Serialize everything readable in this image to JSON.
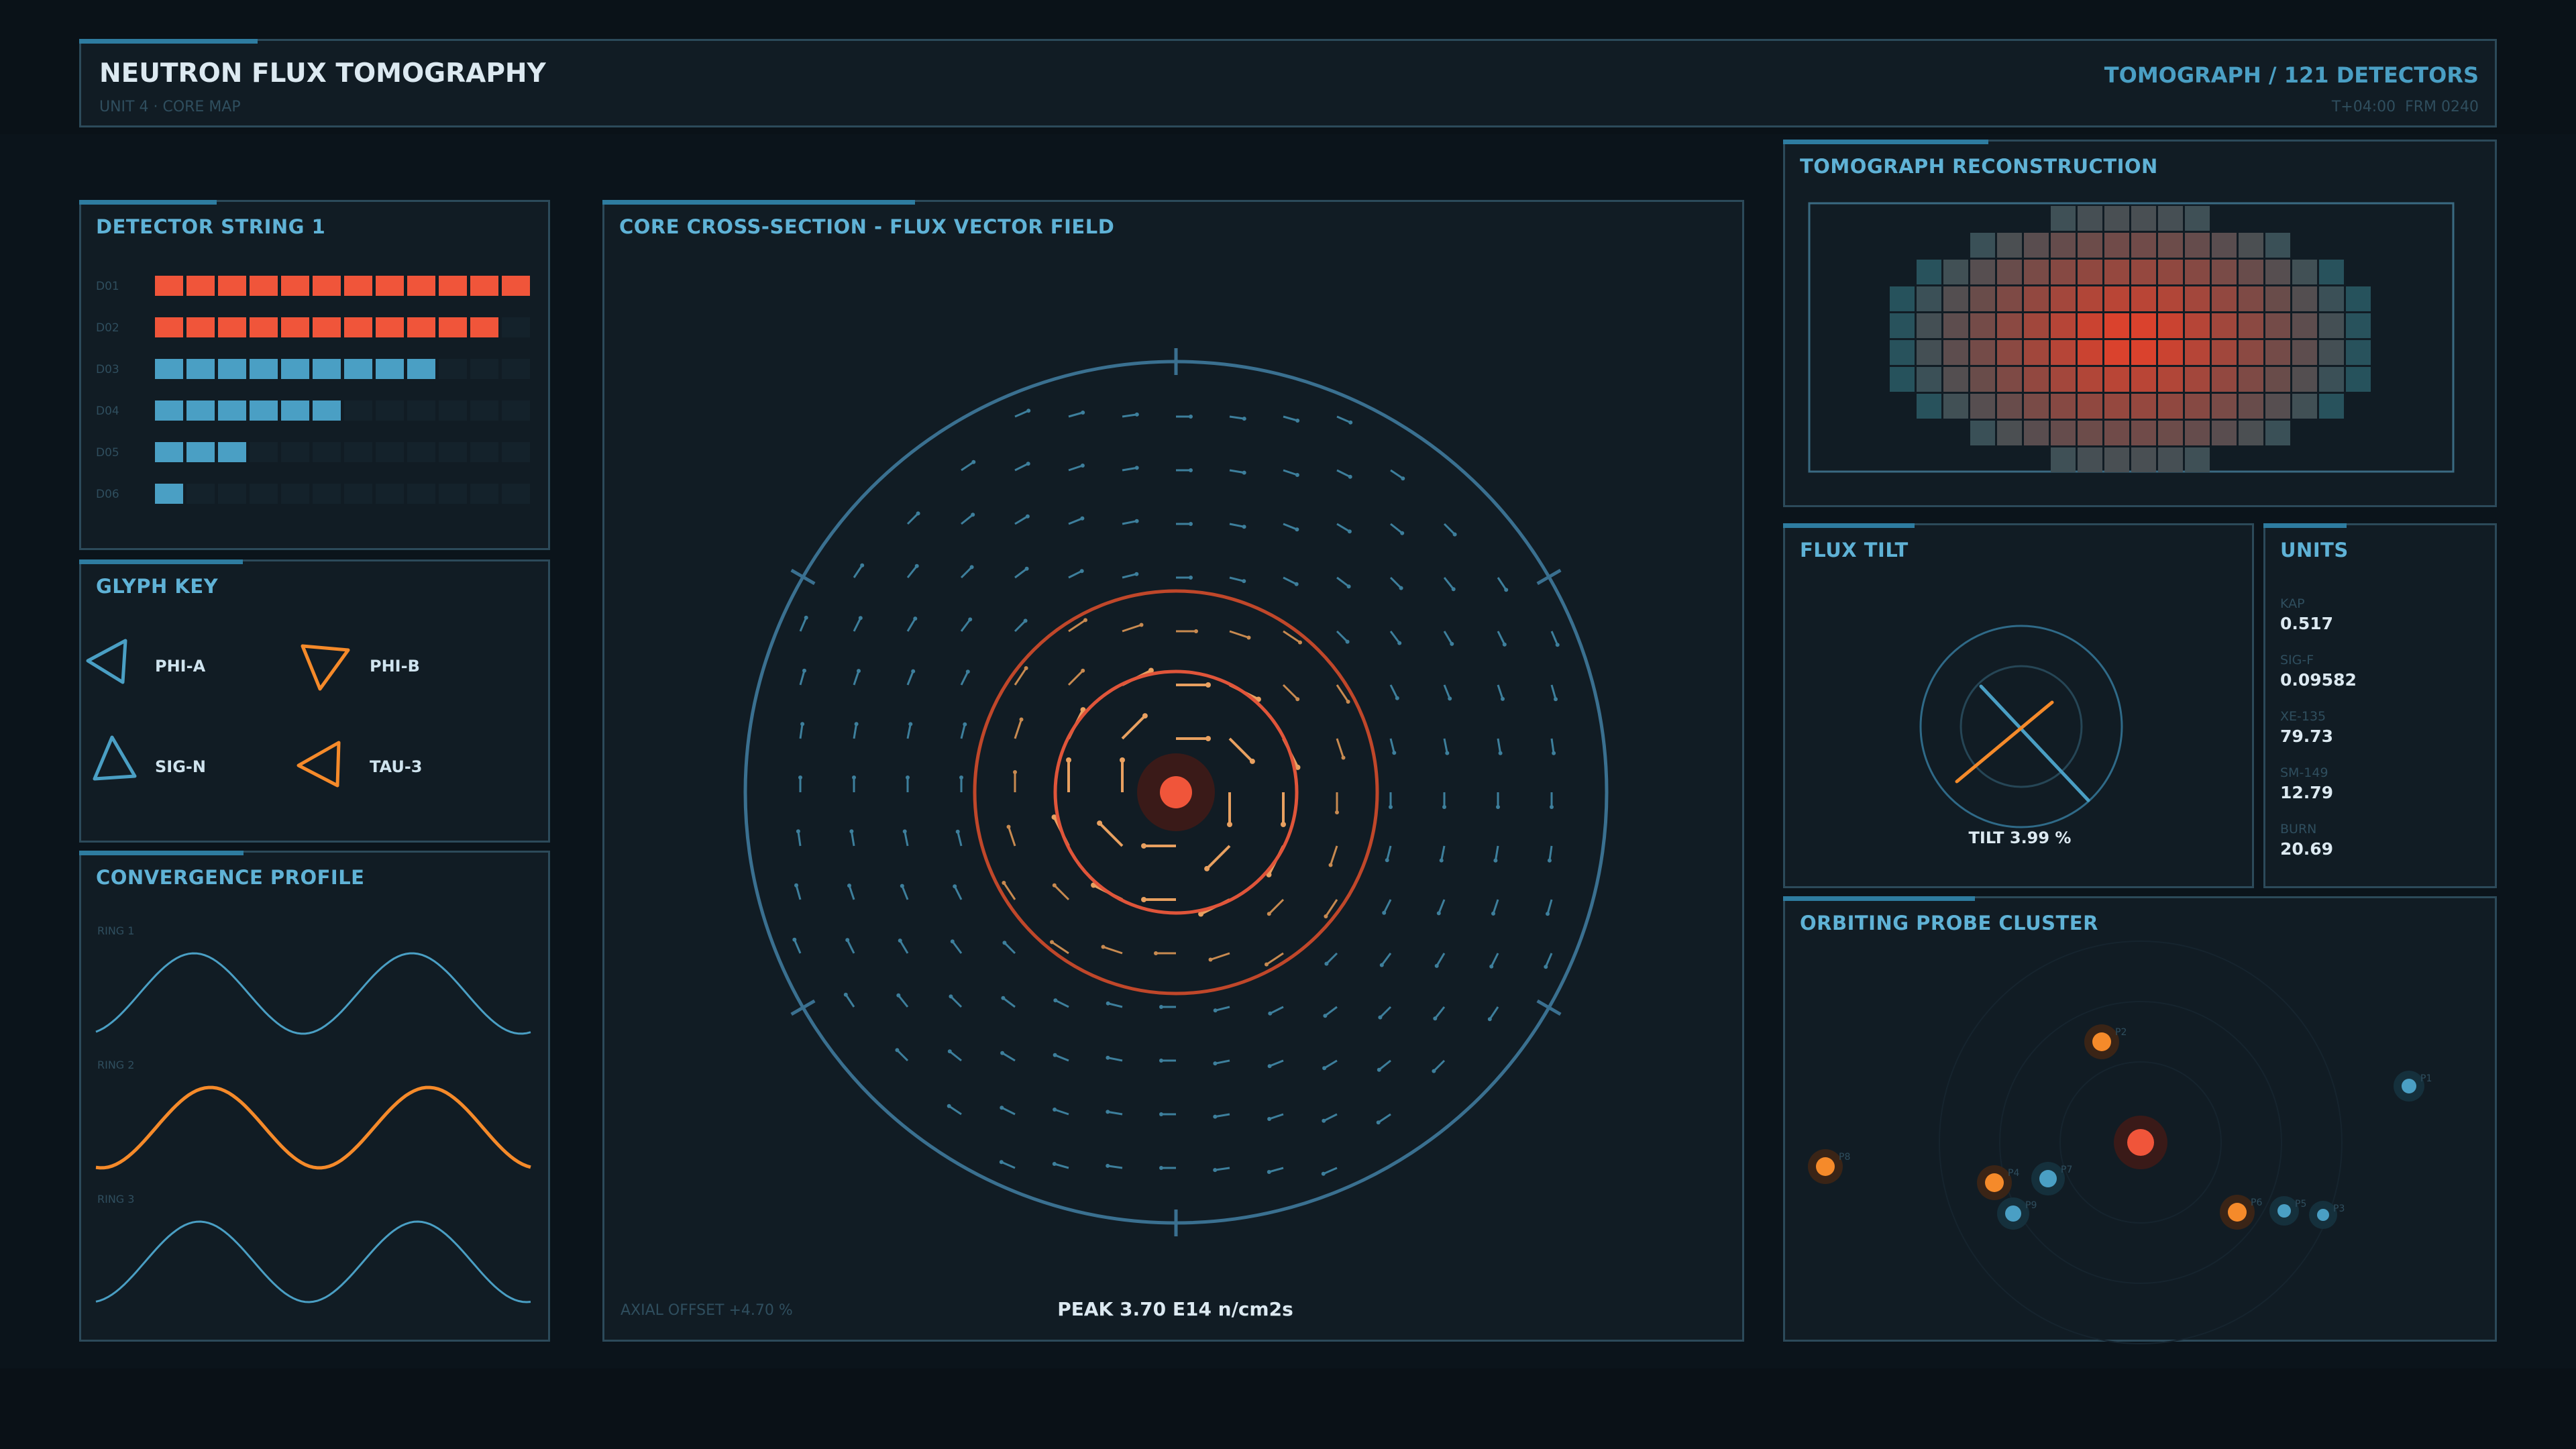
{
  "header": {
    "title": "NEUTRON FLUX TOMOGRAPHY",
    "subtitle": "UNIT 4 · CORE MAP",
    "right_title": "TOMOGRAPH / 121 DETECTORS",
    "right_sub": "T+04:00  FRM 0240"
  },
  "colors": {
    "background": "#0b141b",
    "panel": "#111c24",
    "border": "#2c4a5a",
    "accent_blue": "#4a9fc4",
    "accent_orange": "#f58a2a",
    "accent_red": "#f0553a",
    "title_text": "#5fb2d6"
  },
  "detector_string": {
    "title": "DETECTOR STRING 1",
    "total_cells": 12,
    "rows": [
      {
        "label": "D01",
        "filled": 12,
        "color": "orange"
      },
      {
        "label": "D02",
        "filled": 11,
        "color": "orange"
      },
      {
        "label": "D03",
        "filled": 9,
        "color": "blue"
      },
      {
        "label": "D04",
        "filled": 6,
        "color": "blue"
      },
      {
        "label": "D05",
        "filled": 3,
        "color": "blue"
      },
      {
        "label": "D06",
        "filled": 1,
        "color": "blue"
      }
    ]
  },
  "glyph_key": {
    "title": "GLYPH KEY",
    "items": [
      {
        "label": "PHI-A",
        "color": "blue",
        "glyph": "triangle-left-icon"
      },
      {
        "label": "PHI-B",
        "color": "orange",
        "glyph": "triangle-down-icon"
      },
      {
        "label": "SIG-N",
        "color": "blue",
        "glyph": "triangle-up-icon"
      },
      {
        "label": "TAU-3",
        "color": "orange",
        "glyph": "triangle-left-icon"
      }
    ]
  },
  "convergence": {
    "title": "CONVERGENCE PROFILE",
    "rings": [
      {
        "label": "RING 1",
        "color": "blue"
      },
      {
        "label": "RING 2",
        "color": "orange"
      },
      {
        "label": "RING 3",
        "color": "blue"
      }
    ]
  },
  "core": {
    "title": "CORE CROSS-SECTION - FLUX VECTOR FIELD",
    "axial_offset": "AXIAL OFFSET +4.70 %",
    "peak": "PEAK 3.70 E14 n/cm2s"
  },
  "tomograph": {
    "title": "TOMOGRAPH RECONSTRUCTION",
    "cols": 18,
    "rows": 10
  },
  "flux_tilt": {
    "title": "FLUX TILT",
    "value": "TILT 3.99 %"
  },
  "units": {
    "title": "UNITS",
    "items": [
      {
        "key": "KAP",
        "value": "0.517"
      },
      {
        "key": "SIG-F",
        "value": "0.09582"
      },
      {
        "key": "XE-135",
        "value": "79.73"
      },
      {
        "key": "SM-149",
        "value": "12.79"
      },
      {
        "key": "BURN",
        "value": "20.69"
      }
    ]
  },
  "probes": {
    "title": "ORBITING PROBE CLUSTER",
    "items": [
      {
        "id": "P1",
        "color": "blue"
      },
      {
        "id": "P2",
        "color": "orange"
      },
      {
        "id": "P3",
        "color": "blue"
      },
      {
        "id": "P4",
        "color": "orange"
      },
      {
        "id": "P5",
        "color": "blue"
      },
      {
        "id": "P6",
        "color": "orange"
      },
      {
        "id": "P7",
        "color": "blue"
      },
      {
        "id": "P8",
        "color": "orange"
      },
      {
        "id": "P9",
        "color": "blue"
      }
    ]
  }
}
